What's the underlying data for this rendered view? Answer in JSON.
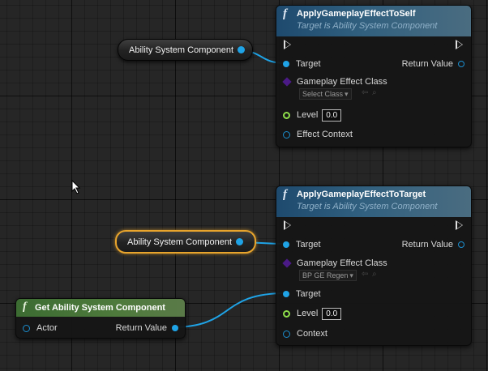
{
  "colors": {
    "object_pin": "#1fa3e6",
    "int_pin": "#8fe04b",
    "class_pin": "#4b1a86",
    "function_header": "#31607f",
    "pure_header": "#4e7a3c",
    "selection": "#e8a42c"
  },
  "icons": {
    "function": "f-function-icon",
    "exec": "exec-pin-icon"
  },
  "node_self": {
    "icon": "f",
    "title": "ApplyGameplayEffectToSelf",
    "subtitle": "Target is Ability System Component",
    "target_label": "Target",
    "return_label": "Return Value",
    "effect_class_label": "Gameplay Effect Class",
    "effect_class_value": "Select Class",
    "level_label": "Level",
    "level_value": "0.0",
    "context_label": "Effect Context"
  },
  "node_target": {
    "icon": "f",
    "title": "ApplyGameplayEffectToTarget",
    "subtitle": "Target is Ability System Component",
    "target_label": "Target",
    "return_label": "Return Value",
    "effect_class_label": "Gameplay Effect Class",
    "effect_class_value": "BP GE Regen",
    "target2_label": "Target",
    "level_label": "Level",
    "level_value": "0.0",
    "context_label": "Context"
  },
  "var_node_1": {
    "label": "Ability System Component"
  },
  "var_node_2": {
    "label": "Ability System Component"
  },
  "get_node": {
    "icon": "f",
    "title": "Get Ability System Component",
    "actor_label": "Actor",
    "return_label": "Return Value"
  }
}
